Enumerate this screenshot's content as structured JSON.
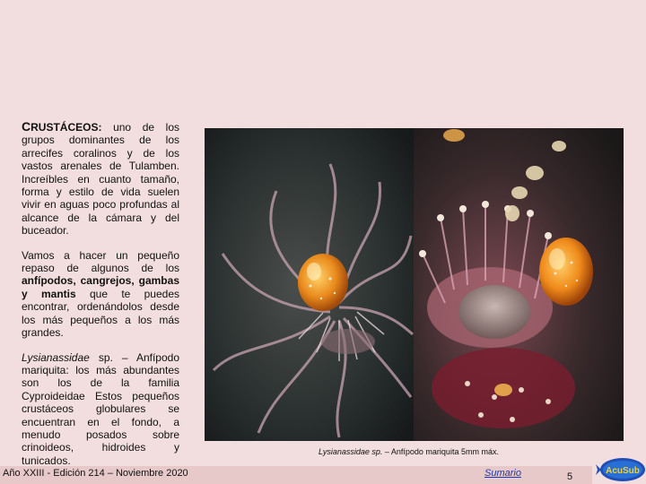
{
  "content": {
    "p1_lead_c": "C",
    "p1_lead_rest": "RUSTÁCEOS:",
    "p1_body": " uno de los grupos dominantes de los arrecifes coralinos y de los vastos arenales de Tulamben. Increíbles en cuanto tamaño, forma y estilo de vida suelen vivir en aguas poco profundas al alcance de la cámara y del buceador.",
    "p2_body_a": "Vamos a hacer un pequeño repaso de algunos de los ",
    "p2_bold": "anfípodos, cangrejos, gambas y mantis",
    "p2_body_b": " que te puedes encontrar, ordenándolos desde los más pequeños a los más grandes.",
    "p3_italic": "Lysianassidae",
    "p3_body": " sp. – Anfípodo mariquita: los más abundantes son los de la familia Cyproideidae Estos pequeños crustáceos globulares se encuentran en el fondo, a menudo posados sobre crinoideos, hidroides y tunicados."
  },
  "caption": {
    "italic": "Lysianassidae sp.",
    "rest": " – Anfípodo mariquita 5mm máx."
  },
  "footer": {
    "edition": "Año XXIII - Edición 214 – Noviembre 2020",
    "summary_link": "Sumario",
    "page_number": "5"
  },
  "logo": {
    "text": "AcuSub"
  }
}
